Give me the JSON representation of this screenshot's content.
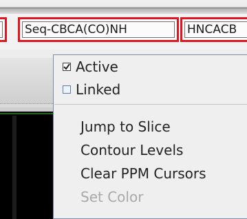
{
  "tabs": [
    {
      "label": ""
    },
    {
      "label": "Seq-CBCA(CO)NH"
    },
    {
      "label": "HNCACB"
    }
  ],
  "menu": {
    "items": [
      {
        "label": "Active",
        "checked": true
      },
      {
        "label": "Linked",
        "checked": false
      },
      {
        "label": "Jump to Slice",
        "enabled": true
      },
      {
        "label": "Contour Levels",
        "enabled": true
      },
      {
        "label": "Clear PPM Cursors",
        "enabled": true
      },
      {
        "label": "Set Color",
        "enabled": false
      }
    ]
  },
  "colors": {
    "tab_border": "#e2141f",
    "menu_bg": "#efefef",
    "canvas_bg": "#000000",
    "contour_green": "#3fcf3f",
    "disabled_text": "#a8a8a8"
  }
}
